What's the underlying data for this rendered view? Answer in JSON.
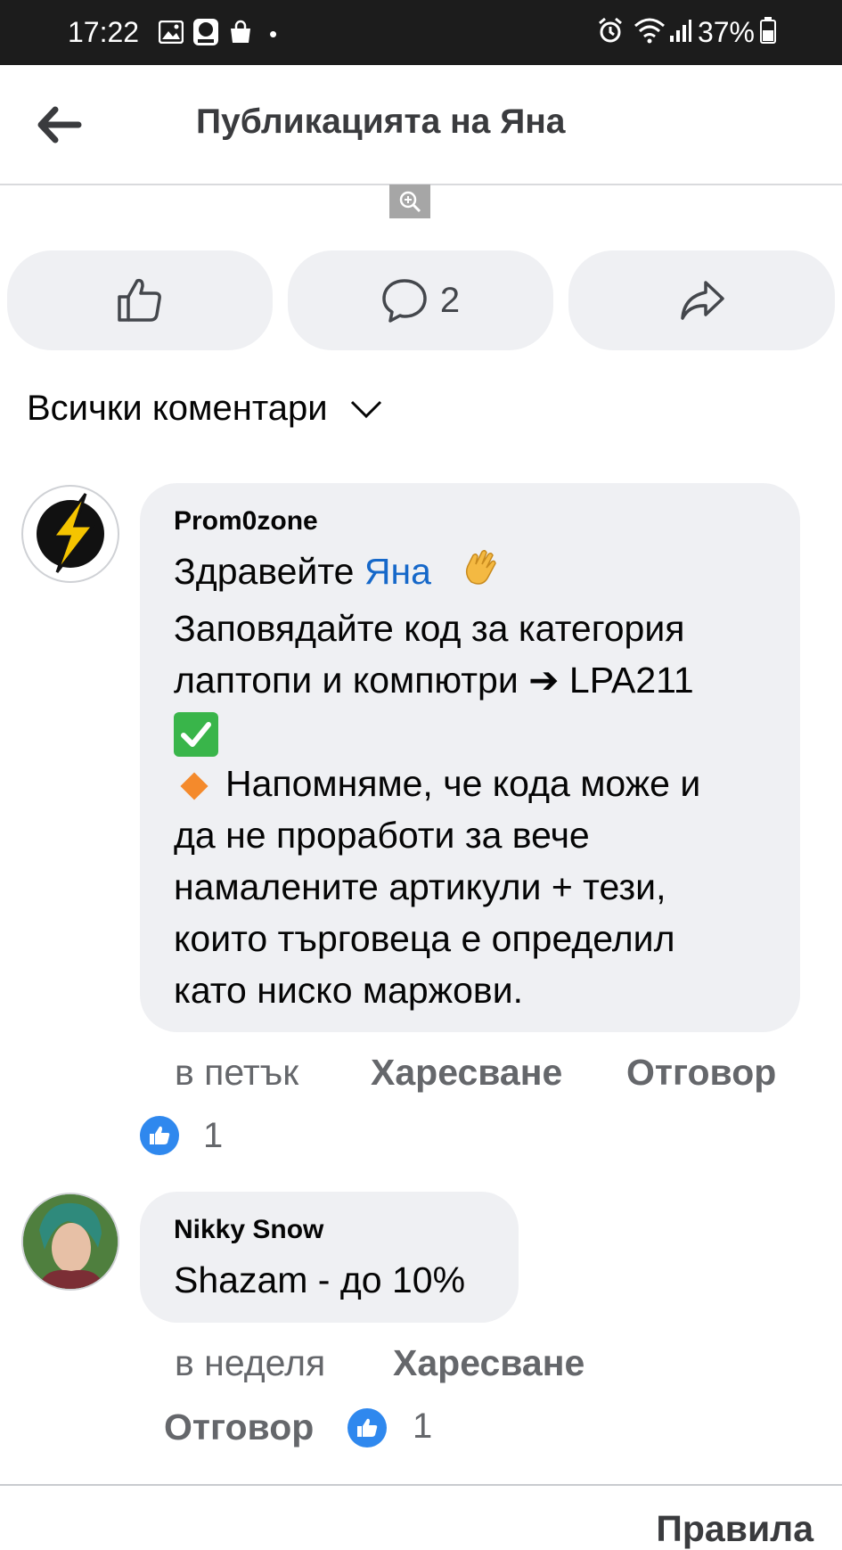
{
  "status_bar": {
    "time": "17:22",
    "dot": "•",
    "battery": "37%",
    "icons_left": [
      "image-icon",
      "lidl-plus-app-icon",
      "shopping-bag-icon"
    ],
    "icons_right": [
      "alarm-icon",
      "wifi-icon",
      "signal-icon",
      "battery-icon"
    ]
  },
  "header": {
    "title": "Публикацията на Яна"
  },
  "actions": {
    "comment_count": "2"
  },
  "filter": {
    "label": "Всички коментари"
  },
  "comments": [
    {
      "author": "Prom0zone",
      "greeting": "Здравейте",
      "mention": "Яна",
      "lines": [
        "Заповядайте код за категория",
        "лаптопи и компютри ➔ LPA211",
        "Напомняме, че кода може и",
        "да не проработи за вече",
        "намалените артикули + тези,",
        "които търговеца е определил",
        "като ниско маржови."
      ],
      "time": "в петък",
      "like_label": "Харесване",
      "reply_label": "Отговор",
      "reaction_count": "1"
    },
    {
      "author": "Nikky Snow",
      "text": "Shazam - до 10%",
      "time": "в неделя",
      "like_label": "Харесване",
      "reply_label": "Отговор",
      "reaction_count": "1"
    }
  ],
  "footer": {
    "rules_label": "Правила"
  },
  "colors": {
    "mention": "#1668c9",
    "pill_background": "#eff0f3",
    "like_reaction": "#2f88ee"
  }
}
